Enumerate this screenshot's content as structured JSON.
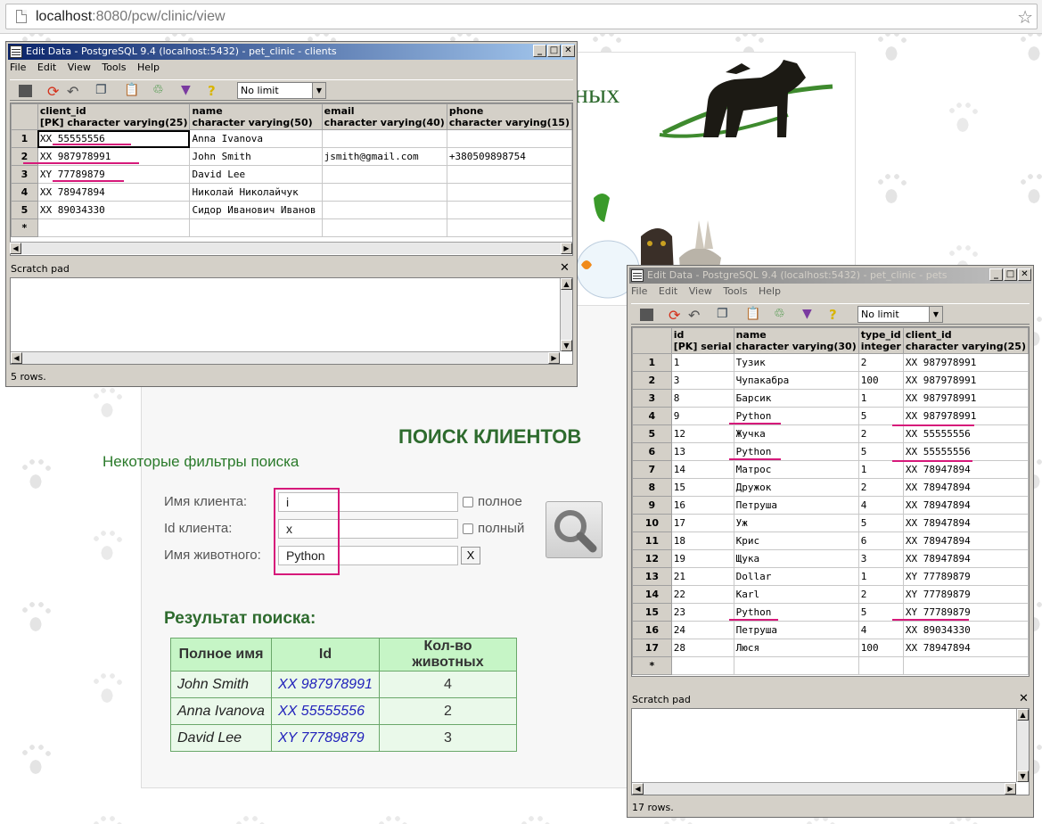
{
  "browser": {
    "url_host": "localhost",
    "url_path": ":8080/pcw/clinic/view"
  },
  "page": {
    "logo_text": "ных",
    "search_title": "ПОИСК КЛИЕНТОВ",
    "filters_title": "Некоторые фильтры поиска",
    "client_name_label": "Имя клиента:",
    "client_name_value": "i",
    "full_label": "полное",
    "client_id_label": "Id клиента:",
    "client_id_value": "x",
    "full_label_2": "полный",
    "pet_name_label": "Имя животного:",
    "pet_name_value": "Python",
    "clear_button": "X",
    "results_title": "Результат поиска:",
    "results_headers": [
      "Полное имя",
      "Id",
      "Кол-во животных"
    ],
    "results": [
      {
        "name": "John Smith",
        "id": "XX 987978991",
        "count": "4"
      },
      {
        "name": "Anna Ivanova",
        "id": "XX 55555556",
        "count": "2"
      },
      {
        "name": "David Lee",
        "id": "XY 77789879",
        "count": "3"
      }
    ]
  },
  "clients_window": {
    "title": "Edit Data - PostgreSQL 9.4 (localhost:5432) - pet_clinic - clients",
    "menu": [
      "File",
      "Edit",
      "View",
      "Tools",
      "Help"
    ],
    "limit": "No limit",
    "columns": [
      {
        "name": "client_id",
        "type": "[PK] character varying(25)"
      },
      {
        "name": "name",
        "type": "character varying(50)"
      },
      {
        "name": "email",
        "type": "character varying(40)"
      },
      {
        "name": "phone",
        "type": "character varying(15)"
      }
    ],
    "rows": [
      {
        "n": "1",
        "client_id": "XX 55555556",
        "name": "Anna Ivanova",
        "email": "",
        "phone": ""
      },
      {
        "n": "2",
        "client_id": "XX 987978991",
        "name": "John Smith",
        "email": "jsmith@gmail.com",
        "phone": "+380509898754"
      },
      {
        "n": "3",
        "client_id": "XY 77789879",
        "name": "David Lee",
        "email": "",
        "phone": ""
      },
      {
        "n": "4",
        "client_id": "XX 78947894",
        "name": "Николай Николайчук",
        "email": "",
        "phone": ""
      },
      {
        "n": "5",
        "client_id": "XX 89034330",
        "name": "Сидор Иванович Иванов",
        "email": "",
        "phone": ""
      }
    ],
    "new_row_marker": "*",
    "scratch_label": "Scratch pad",
    "status": "5 rows."
  },
  "pets_window": {
    "title": "Edit Data - PostgreSQL 9.4 (localhost:5432) - pet_clinic - pets",
    "menu": [
      "File",
      "Edit",
      "View",
      "Tools",
      "Help"
    ],
    "limit": "No limit",
    "columns": [
      {
        "name": "id",
        "type": "[PK] serial"
      },
      {
        "name": "name",
        "type": "character varying(30)"
      },
      {
        "name": "type_id",
        "type": "integer"
      },
      {
        "name": "client_id",
        "type": "character varying(25)"
      }
    ],
    "rows": [
      {
        "n": "1",
        "id": "1",
        "name": "Тузик",
        "type_id": "2",
        "client_id": "XX 987978991"
      },
      {
        "n": "2",
        "id": "3",
        "name": "Чупакабра",
        "type_id": "100",
        "client_id": "XX 987978991"
      },
      {
        "n": "3",
        "id": "8",
        "name": "Барсик",
        "type_id": "1",
        "client_id": "XX 987978991"
      },
      {
        "n": "4",
        "id": "9",
        "name": "Python",
        "type_id": "5",
        "client_id": "XX 987978991"
      },
      {
        "n": "5",
        "id": "12",
        "name": "Жучка",
        "type_id": "2",
        "client_id": "XX 55555556"
      },
      {
        "n": "6",
        "id": "13",
        "name": "Python",
        "type_id": "5",
        "client_id": "XX 55555556"
      },
      {
        "n": "7",
        "id": "14",
        "name": "Матрос",
        "type_id": "1",
        "client_id": "XX 78947894"
      },
      {
        "n": "8",
        "id": "15",
        "name": "Дружок",
        "type_id": "2",
        "client_id": "XX 78947894"
      },
      {
        "n": "9",
        "id": "16",
        "name": "Петруша",
        "type_id": "4",
        "client_id": "XX 78947894"
      },
      {
        "n": "10",
        "id": "17",
        "name": "Уж",
        "type_id": "5",
        "client_id": "XX 78947894"
      },
      {
        "n": "11",
        "id": "18",
        "name": "Крис",
        "type_id": "6",
        "client_id": "XX 78947894"
      },
      {
        "n": "12",
        "id": "19",
        "name": "Щука",
        "type_id": "3",
        "client_id": "XX 78947894"
      },
      {
        "n": "13",
        "id": "21",
        "name": "Dollar",
        "type_id": "1",
        "client_id": "XY 77789879"
      },
      {
        "n": "14",
        "id": "22",
        "name": "Karl",
        "type_id": "2",
        "client_id": "XY 77789879"
      },
      {
        "n": "15",
        "id": "23",
        "name": "Python",
        "type_id": "5",
        "client_id": "XY 77789879"
      },
      {
        "n": "16",
        "id": "24",
        "name": "Петруша",
        "type_id": "4",
        "client_id": "XX 89034330"
      },
      {
        "n": "17",
        "id": "28",
        "name": "Люся",
        "type_id": "100",
        "client_id": "XX 78947894"
      }
    ],
    "new_row_marker": "*",
    "scratch_label": "Scratch pad",
    "status": "17 rows."
  },
  "colors": {
    "highlight": "#d6197a",
    "heading_green": "#2e6b2e",
    "link_blue": "#2222bb",
    "table_header_bg": "#c6f5c6"
  }
}
